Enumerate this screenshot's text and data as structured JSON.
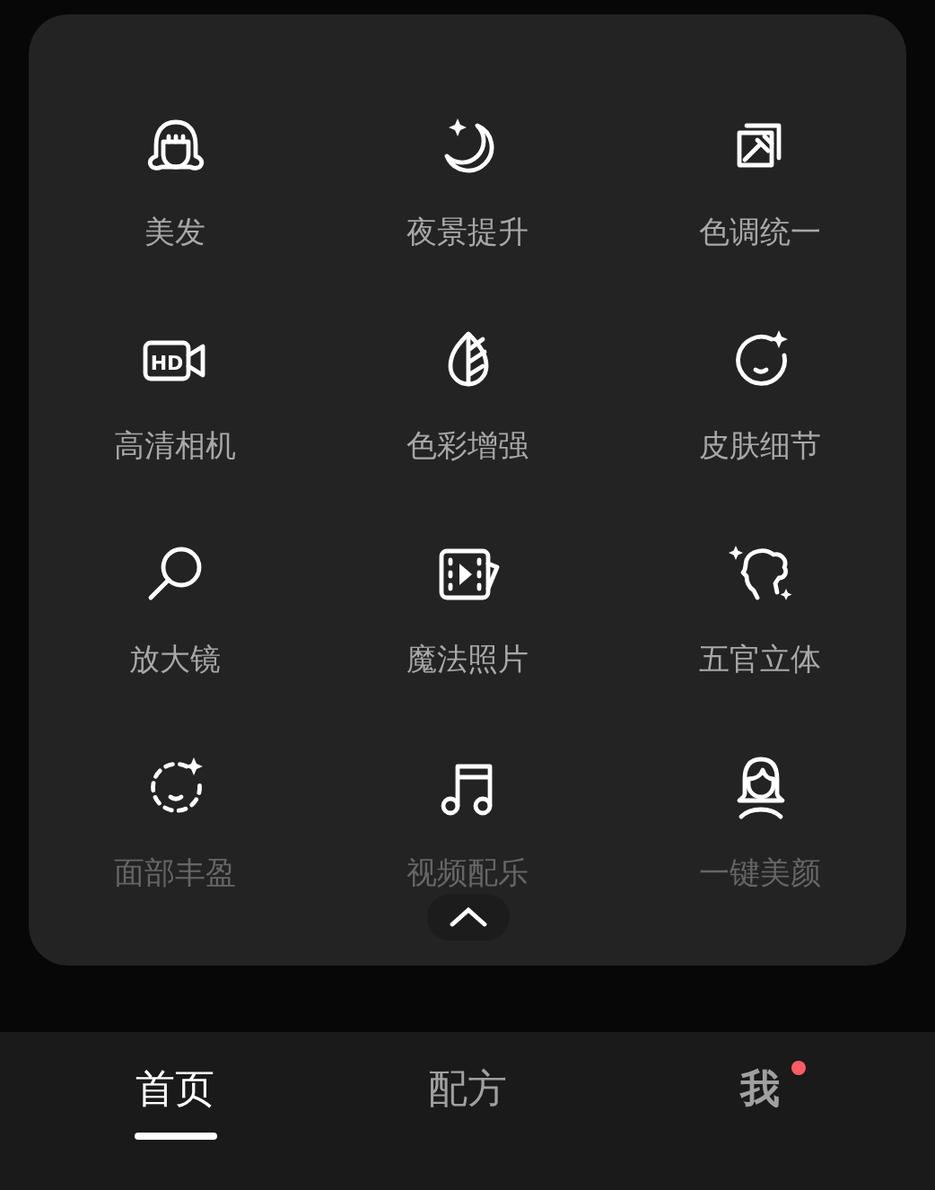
{
  "tools": [
    {
      "label": "美发",
      "dimmed": false
    },
    {
      "label": "夜景提升",
      "dimmed": false
    },
    {
      "label": "色调统一",
      "dimmed": false
    },
    {
      "label": "高清相机",
      "dimmed": false,
      "icon_text": "HD"
    },
    {
      "label": "色彩增强",
      "dimmed": false
    },
    {
      "label": "皮肤细节",
      "dimmed": false
    },
    {
      "label": "放大镜",
      "dimmed": false
    },
    {
      "label": "魔法照片",
      "dimmed": false
    },
    {
      "label": "五官立体",
      "dimmed": false
    },
    {
      "label": "面部丰盈",
      "dimmed": true
    },
    {
      "label": "视频配乐",
      "dimmed": true
    },
    {
      "label": "一键美颜",
      "dimmed": true
    }
  ],
  "nav_tabs": [
    {
      "label": "首页",
      "selected": true,
      "badge": false
    },
    {
      "label": "配方",
      "selected": false,
      "badge": false
    },
    {
      "label": "我",
      "selected": false,
      "badge": true
    }
  ]
}
